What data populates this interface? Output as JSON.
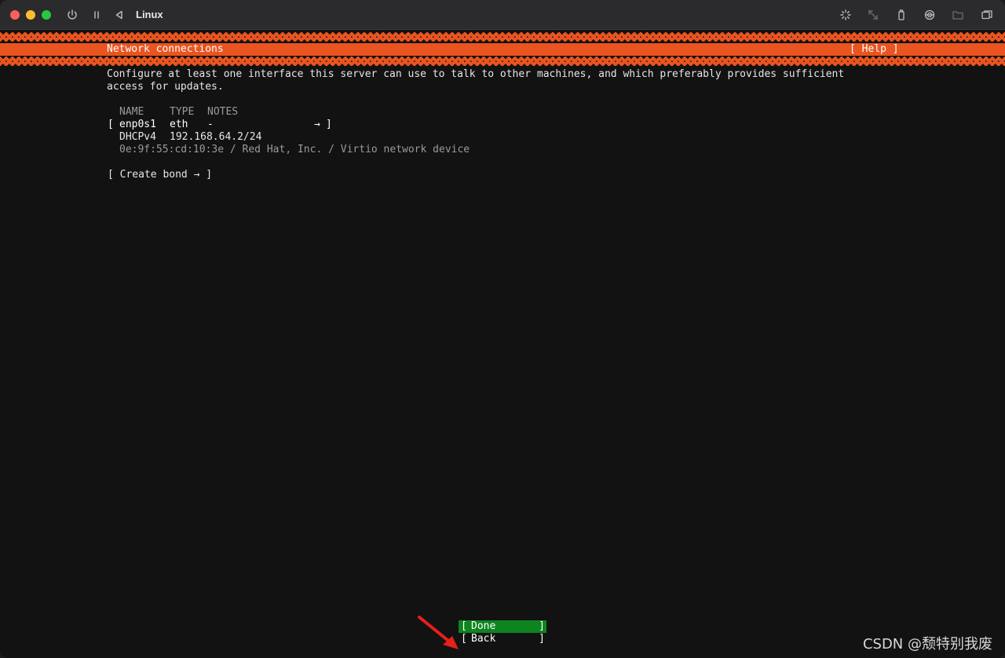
{
  "window": {
    "title": "Linux"
  },
  "installer": {
    "header_title": "Network connections",
    "help_label": "[ Help ]",
    "description_line1": "Configure at least one interface this server can use to talk to other machines, and which preferably provides sufficient",
    "description_line2": "access for updates.",
    "table": {
      "headers": {
        "name": "NAME",
        "type": "TYPE",
        "notes": "NOTES"
      },
      "interface": {
        "open_bracket": "[",
        "name": "enp0s1",
        "type": "eth",
        "notes": "-",
        "arrow": "→",
        "close_bracket": "]",
        "addr_proto": "DHCPv4",
        "addr_value": "192.168.64.2/24",
        "mac_info": "0e:9f:55:cd:10:3e / Red Hat, Inc. / Virtio network device"
      }
    },
    "create_bond_label": "[ Create bond → ]",
    "buttons": {
      "done": {
        "open": "[",
        "label": "Done",
        "close": "]"
      },
      "back": {
        "open": "[",
        "label": "Back",
        "close": "]"
      }
    }
  },
  "watermark": "CSDN @颓特别我废",
  "colors": {
    "accent": "#e95420",
    "done_bg": "#0e8420",
    "terminal_bg": "#121212",
    "annotation_arrow": "#e8201a"
  }
}
